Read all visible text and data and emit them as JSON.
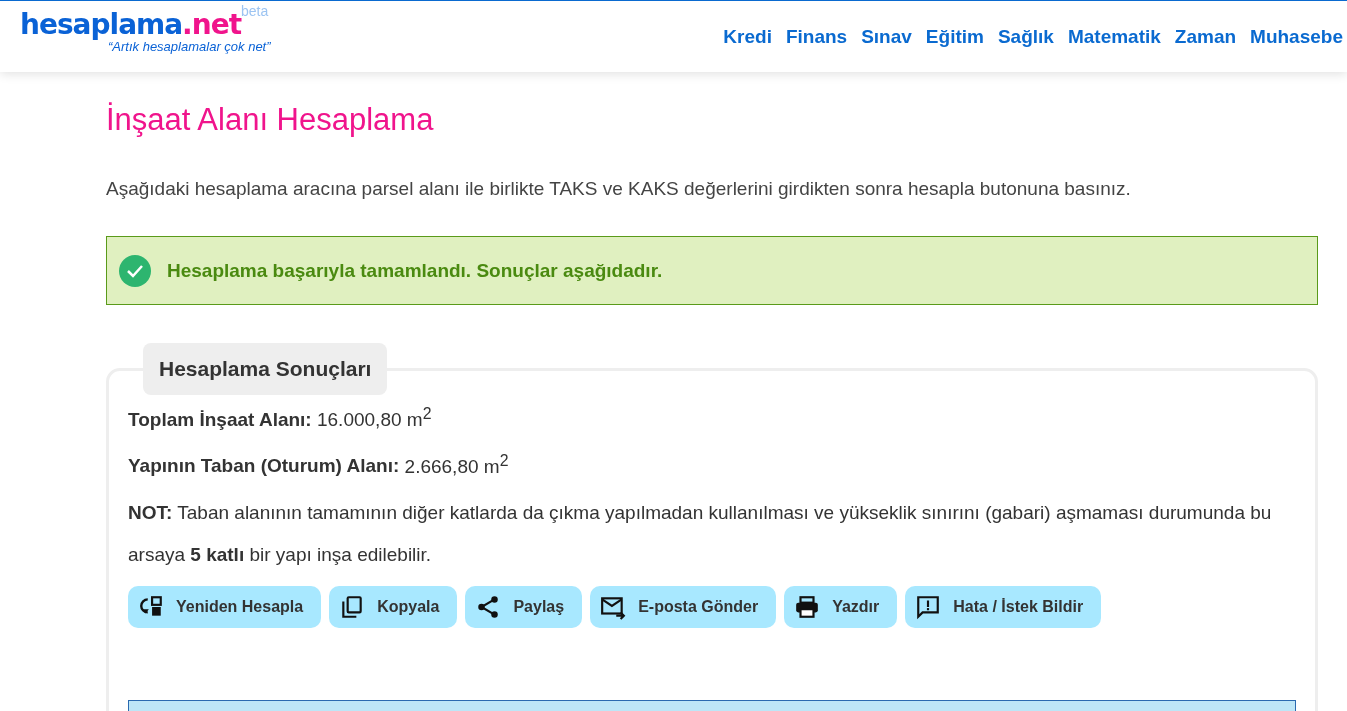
{
  "header": {
    "logo": {
      "name": "hesaplama",
      "tld": ".net",
      "badge": "beta",
      "slogan": "“Artık hesaplamalar çok net”"
    },
    "nav": [
      "Kredi",
      "Finans",
      "Sınav",
      "Eğitim",
      "Sağlık",
      "Matematik",
      "Zaman",
      "Muhasebe"
    ]
  },
  "title": "İnşaat Alanı Hesaplama",
  "intro": "Aşağıdaki hesaplama aracına parsel alanı ile birlikte TAKS ve KAKS değerlerini girdikten sonra hesapla butonuna basınız.",
  "alert": {
    "kind": "success",
    "text": "Hesaplama başarıyla tamamlandı. Sonuçlar aşağıdadır."
  },
  "results": {
    "legend": "Hesaplama Sonuçları",
    "lines": [
      {
        "label": "Toplam İnşaat Alanı:",
        "value": "16.000,80 m$^{2}$"
      },
      {
        "label": "Yapının Taban (Oturum) Alanı:",
        "value": "2.666,80 m$^{2}$"
      }
    ],
    "note": "**NOT:** Taban alanının tamamının diğer katlarda da çıkma yapılmadan kullanılması ve yükseklik sınırını (gabari) aşmaması durumunda bu arsaya **5 katlı** bir yapı inşa edilebilir.",
    "actions": [
      "Yeniden Hesapla",
      "Kopyala",
      "Paylaş",
      "E-posta Gönder",
      "Yazdır",
      "Hata / İstek Bildir"
    ]
  }
}
